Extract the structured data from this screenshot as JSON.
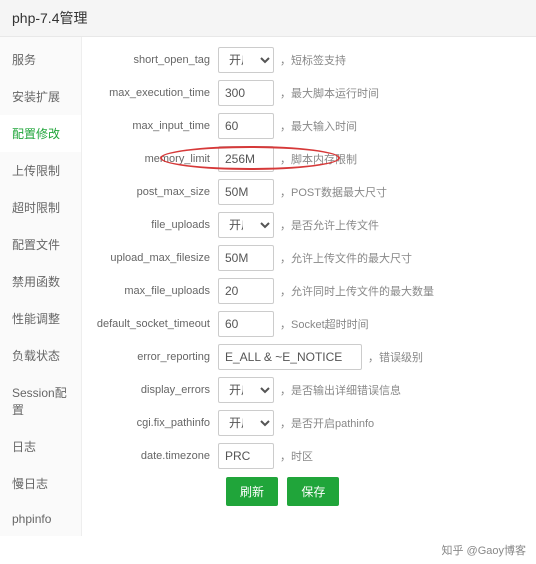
{
  "header": {
    "title": "php-7.4管理"
  },
  "sidebar": {
    "items": [
      {
        "label": "服务"
      },
      {
        "label": "安装扩展"
      },
      {
        "label": "配置修改"
      },
      {
        "label": "上传限制"
      },
      {
        "label": "超时限制"
      },
      {
        "label": "配置文件"
      },
      {
        "label": "禁用函数"
      },
      {
        "label": "性能调整"
      },
      {
        "label": "负载状态"
      },
      {
        "label": "Session配置"
      },
      {
        "label": "日志"
      },
      {
        "label": "慢日志"
      },
      {
        "label": "phpinfo"
      }
    ],
    "activeIndex": 2
  },
  "select_option": "开启",
  "settings": [
    {
      "key": "short_open_tag",
      "type": "select",
      "value": "开启",
      "desc": "短标签支持"
    },
    {
      "key": "max_execution_time",
      "type": "text",
      "value": "300",
      "desc": "最大脚本运行时间"
    },
    {
      "key": "max_input_time",
      "type": "text",
      "value": "60",
      "desc": "最大输入时间"
    },
    {
      "key": "memory_limit",
      "type": "text",
      "value": "256M",
      "desc": "脚本内存限制",
      "highlight": true
    },
    {
      "key": "post_max_size",
      "type": "text",
      "value": "50M",
      "desc": "POST数据最大尺寸"
    },
    {
      "key": "file_uploads",
      "type": "select",
      "value": "开启",
      "desc": "是否允许上传文件"
    },
    {
      "key": "upload_max_filesize",
      "type": "text",
      "value": "50M",
      "desc": "允许上传文件的最大尺寸"
    },
    {
      "key": "max_file_uploads",
      "type": "text",
      "value": "20",
      "desc": "允许同时上传文件的最大数量"
    },
    {
      "key": "default_socket_timeout",
      "type": "text",
      "value": "60",
      "desc": "Socket超时时间"
    },
    {
      "key": "error_reporting",
      "type": "text-wide",
      "value": "E_ALL & ~E_NOTICE",
      "desc": "错误级别"
    },
    {
      "key": "display_errors",
      "type": "select",
      "value": "开启",
      "desc": "是否输出详细错误信息"
    },
    {
      "key": "cgi.fix_pathinfo",
      "type": "select",
      "value": "开启",
      "desc": "是否开启pathinfo"
    },
    {
      "key": "date.timezone",
      "type": "text",
      "value": "PRC",
      "desc": "时区"
    }
  ],
  "buttons": {
    "refresh": "刷新",
    "save": "保存"
  },
  "footer": {
    "text": "知乎 @Gaoy博客"
  }
}
